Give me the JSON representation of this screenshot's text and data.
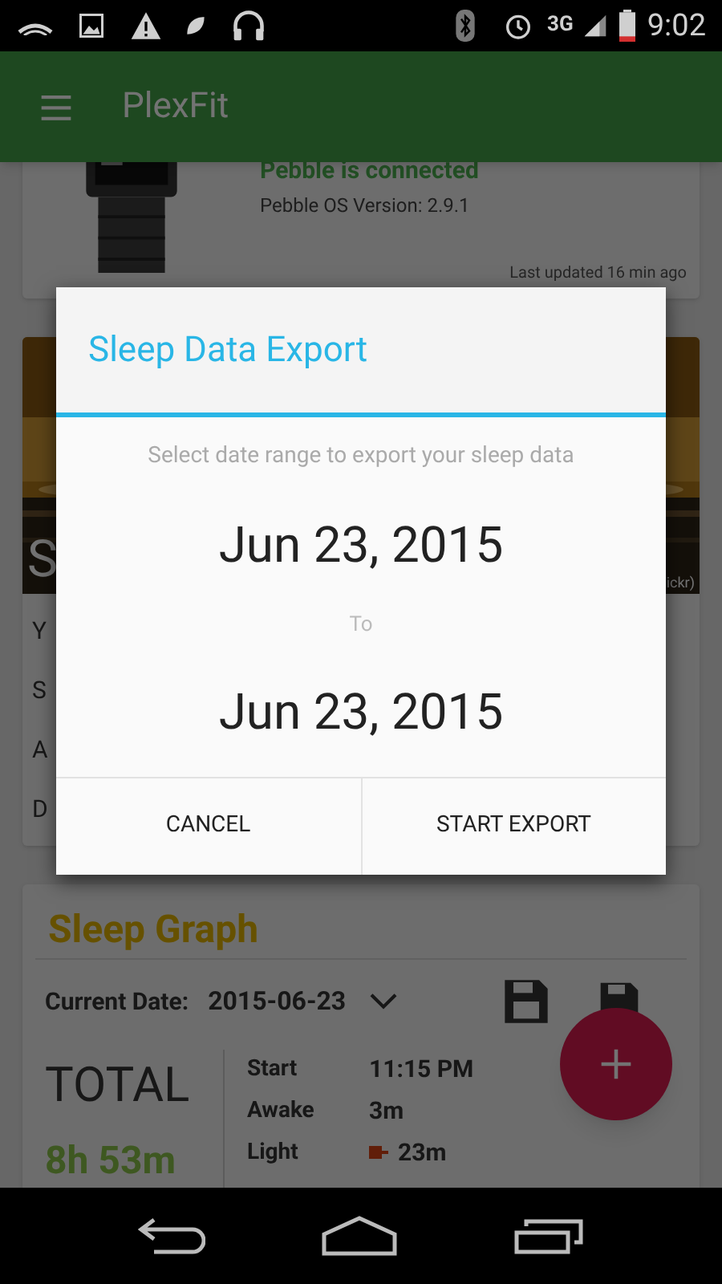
{
  "status_bar": {
    "network": "3G",
    "time": "9:02"
  },
  "app_bar": {
    "title": "PlexFit"
  },
  "device_card": {
    "status": "Pebble is connected",
    "os_version": "Pebble OS Version: 2.9.1",
    "updated": "Last updated 16 min ago"
  },
  "photo_card": {
    "caption": "S",
    "credit": "ickr)",
    "lines": [
      "Y",
      "S",
      "A",
      "D"
    ]
  },
  "sleep_card": {
    "title": "Sleep Graph",
    "date_label": "Current Date:",
    "date": "2015-06-23",
    "total_label": "TOTAL",
    "total": "8h 53m",
    "stats": [
      {
        "label": "Start",
        "value": "11:15 PM",
        "marker": false
      },
      {
        "label": "Awake",
        "value": "3m",
        "marker": false
      },
      {
        "label": "Light",
        "value": "23m",
        "marker": true
      }
    ]
  },
  "dialog": {
    "title": "Sleep Data Export",
    "subtitle": "Select date range to export your sleep data",
    "from": "Jun 23, 2015",
    "separator": "To",
    "to": "Jun 23, 2015",
    "buttons": [
      "CANCEL",
      "START EXPORT"
    ]
  }
}
